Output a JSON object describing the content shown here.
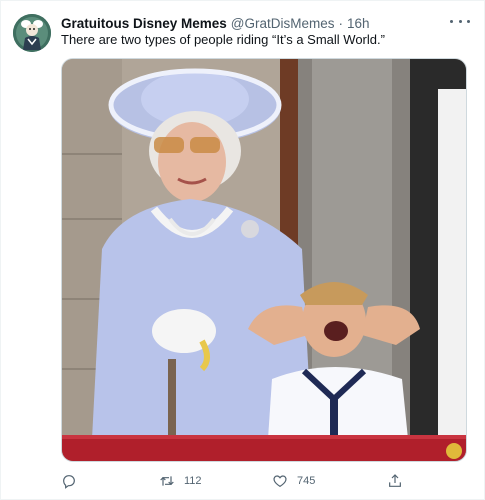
{
  "tweet": {
    "author_name": "Gratuitous Disney Memes",
    "author_handle": "@GratDisMemes",
    "separator": "·",
    "timestamp": "16h",
    "text": "There are two types of people riding “It’s a Small World.”",
    "media_icon": "photo",
    "avatar_icon": "disney-character-avatar"
  },
  "actions": {
    "reply_icon": "reply-icon",
    "retweet_icon": "retweet-icon",
    "retweet_count": "112",
    "like_icon": "heart-icon",
    "like_count": "745",
    "share_icon": "share-icon"
  },
  "colors": {
    "text_primary": "#0f1419",
    "text_secondary": "#536471",
    "border": "#cfd9de"
  }
}
